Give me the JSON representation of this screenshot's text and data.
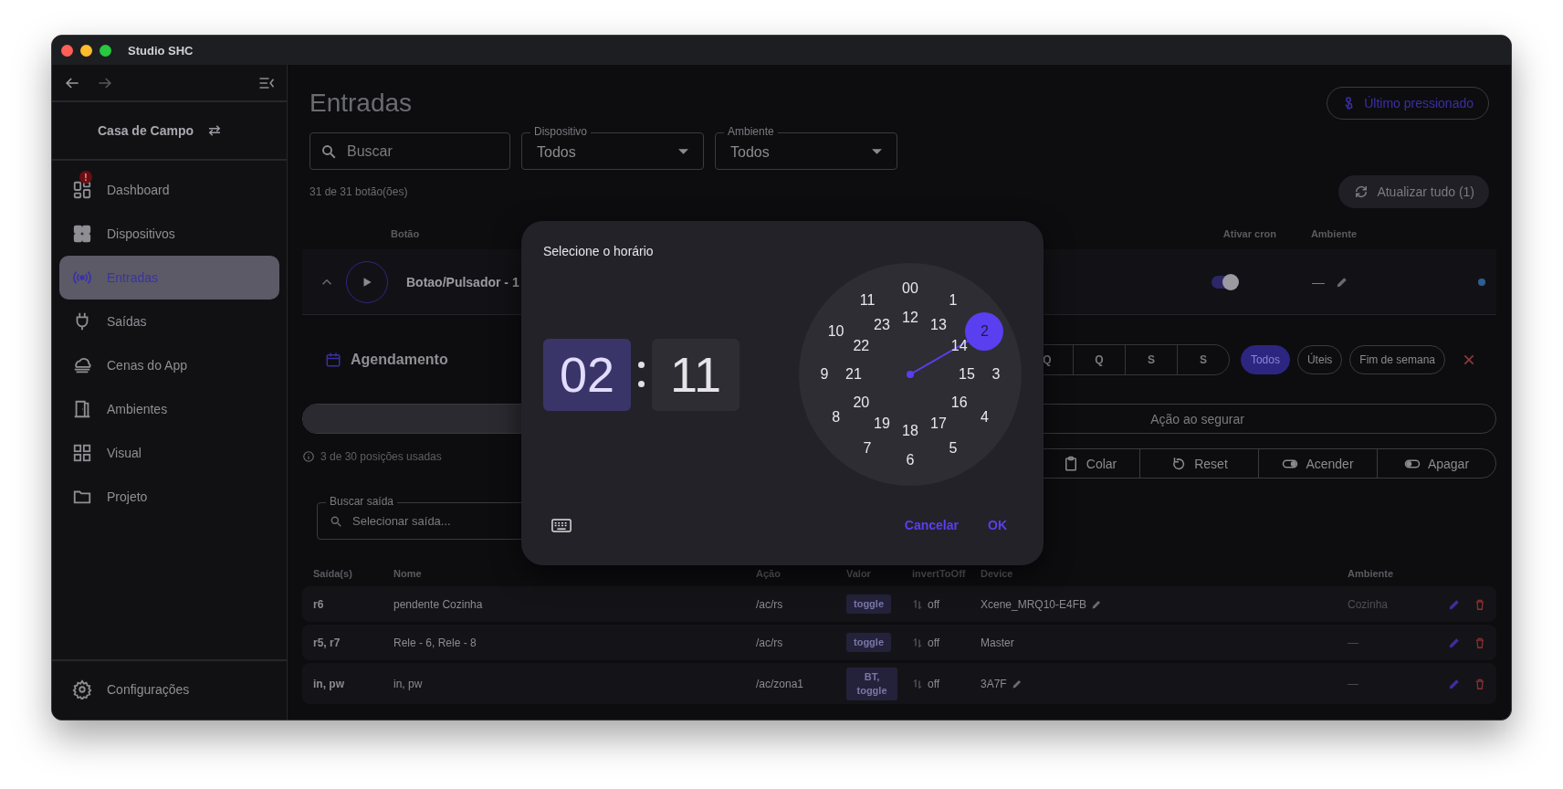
{
  "window": {
    "title": "Studio SHC"
  },
  "sidebar": {
    "workspace": "Casa de Campo",
    "items": [
      {
        "label": "Dashboard",
        "selected": false,
        "badge": "!"
      },
      {
        "label": "Dispositivos",
        "selected": false
      },
      {
        "label": "Entradas",
        "selected": true
      },
      {
        "label": "Saídas",
        "selected": false
      },
      {
        "label": "Cenas do App",
        "selected": false
      },
      {
        "label": "Ambientes",
        "selected": false
      },
      {
        "label": "Visual",
        "selected": false
      },
      {
        "label": "Projeto",
        "selected": false
      }
    ],
    "footer": "Configurações"
  },
  "page": {
    "title": "Entradas",
    "last_pressed_button": "Último pressionado"
  },
  "filters": {
    "search": {
      "placeholder": "Buscar"
    },
    "selects": [
      {
        "label": "Dispositivo",
        "value": "Todos"
      },
      {
        "label": "Ambiente",
        "value": "Todos"
      }
    ]
  },
  "count": "31 de 31 botão(ões)",
  "refresh_button": "Atualizar tudo (1)",
  "table": {
    "columns": [
      "Botão",
      "Ativar cron",
      "Ambiente"
    ]
  },
  "input_row": {
    "name": "Botao/Pulsador - 1",
    "expanded": true,
    "cron_on": true,
    "ambiente": "—"
  },
  "schedule": {
    "title": "Agendamento",
    "days": [
      {
        "label": "Q",
        "selected": false
      },
      {
        "label": "Q",
        "selected": false
      },
      {
        "label": "S",
        "selected": false
      },
      {
        "label": "S",
        "selected": false
      }
    ],
    "presets": [
      {
        "label": "Todos",
        "selected": true
      },
      {
        "label": "Úteis",
        "selected": false
      },
      {
        "label": "Fim de semana",
        "selected": false
      }
    ]
  },
  "action_tab": "Ação ao segurar",
  "usage": "3 de 30 posições usadas",
  "tools": [
    "Colar",
    "Reset",
    "Acender",
    "Apagar"
  ],
  "output_search": {
    "label": "Buscar saída",
    "placeholder": "Selecionar saída..."
  },
  "outputs": {
    "columns": [
      "Saída(s)",
      "Nome",
      "Ação",
      "Valor",
      "invertToOff",
      "Device",
      "Ambiente"
    ],
    "rows": [
      {
        "outputs": "r6",
        "name": "pendente Cozinha",
        "action": "/ac/rs",
        "value": "toggle",
        "invert": "off",
        "device": "Xcene_MRQ10-E4FB",
        "device_editable": true,
        "ambiente": "Cozinha"
      },
      {
        "outputs": "r5, r7",
        "name": "Rele - 6, Rele - 8",
        "action": "/ac/rs",
        "value": "toggle",
        "invert": "off",
        "device": "Master",
        "device_editable": false,
        "ambiente": "—"
      },
      {
        "outputs": "in, pw",
        "name": "in, pw",
        "action": "/ac/zona1",
        "value": "BT, toggle",
        "invert": "off",
        "device": "3A7F",
        "device_editable": true,
        "ambiente": "—"
      }
    ]
  },
  "dialog": {
    "title": "Selecione o horário",
    "hour": {
      "value": "02",
      "selected": true
    },
    "minute": {
      "value": "11",
      "selected": false
    },
    "outer": [
      {
        "label": "00",
        "selected": false
      },
      {
        "label": "1",
        "selected": false
      },
      {
        "label": "2",
        "selected": true
      },
      {
        "label": "3",
        "selected": false
      },
      {
        "label": "4",
        "selected": false
      },
      {
        "label": "5",
        "selected": false
      },
      {
        "label": "6",
        "selected": false
      },
      {
        "label": "7",
        "selected": false
      },
      {
        "label": "8",
        "selected": false
      },
      {
        "label": "9",
        "selected": false
      },
      {
        "label": "10",
        "selected": false
      },
      {
        "label": "11",
        "selected": false
      }
    ],
    "inner": [
      {
        "label": "12",
        "selected": false
      },
      {
        "label": "13",
        "selected": false
      },
      {
        "label": "14",
        "selected": false
      },
      {
        "label": "15",
        "selected": false
      },
      {
        "label": "16",
        "selected": false
      },
      {
        "label": "17",
        "selected": false
      },
      {
        "label": "18",
        "selected": false
      },
      {
        "label": "19",
        "selected": false
      },
      {
        "label": "20",
        "selected": false
      },
      {
        "label": "21",
        "selected": false
      },
      {
        "label": "22",
        "selected": false
      },
      {
        "label": "23",
        "selected": false
      }
    ],
    "buttons": [
      "Cancelar",
      "OK"
    ]
  }
}
